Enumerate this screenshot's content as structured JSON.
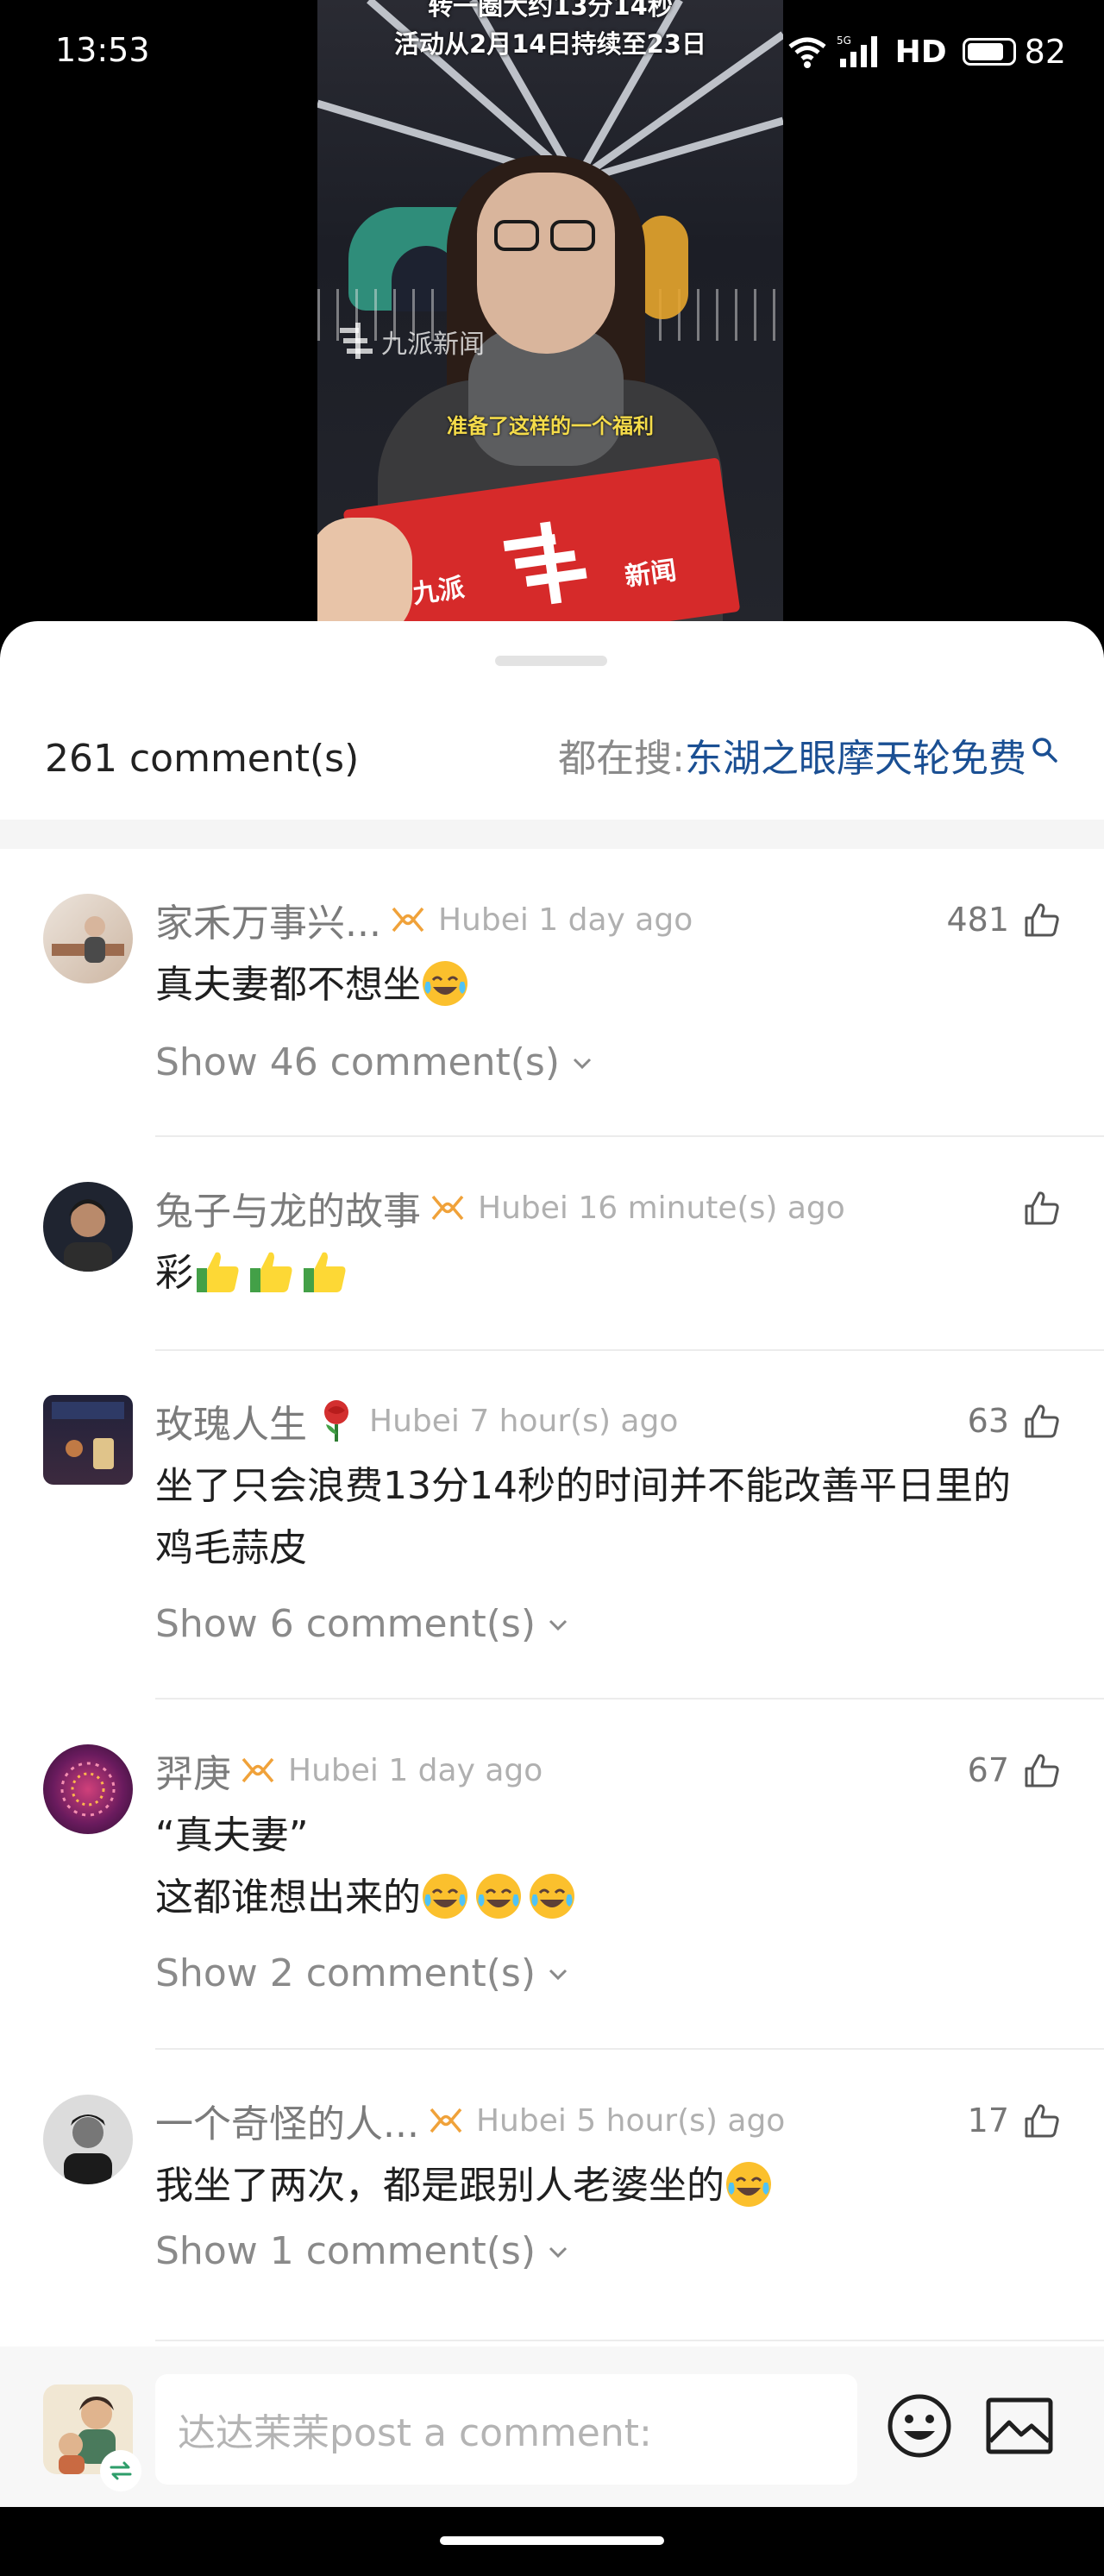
{
  "status_bar": {
    "time": "13:53",
    "network": "5G",
    "hd": "HD",
    "battery": "82",
    "battery_level": 0.82
  },
  "video": {
    "caption_partial": "转一圈大约13分14秒",
    "caption_top": "活动从2月14日持续至23日",
    "subtitle": "准备了这样的一个福利",
    "watermark": "九派新闻",
    "box_text_left": "九派",
    "box_text_right": "新闻"
  },
  "header": {
    "comment_count": "261 comment(s)",
    "trending_label": "都在搜: ",
    "trending_query": "东湖之眼摩天轮免费"
  },
  "comments": [
    {
      "username": "家禾万事兴...",
      "location_time": "Hubei 1 day ago",
      "likes": "481",
      "content": "真夫妻都不想坐",
      "replies": "Show 46 comment(s)"
    },
    {
      "username": "兔子与龙的故事",
      "location_time": "Hubei 16 minute(s) ago",
      "likes": "",
      "content": "彩"
    },
    {
      "username": "玫瑰人生",
      "location_time": "Hubei 7 hour(s) ago",
      "likes": "63",
      "content_line1": "坐了只会浪费13分14秒的时间并不能改善平日里的",
      "content_line2": "鸡毛蒜皮",
      "replies": "Show 6 comment(s)"
    },
    {
      "username": "羿庚",
      "location_time": "Hubei 1 day ago",
      "likes": "67",
      "content_line1": "“真夫妻”",
      "content_line2": "这都谁想出来的",
      "replies": "Show 2 comment(s)"
    },
    {
      "username": "一个奇怪的人...",
      "location_time": "Hubei 5 hour(s) ago",
      "likes": "17",
      "content": "我坐了两次，都是跟别人老婆坐的",
      "replies": "Show 1 comment(s)"
    }
  ],
  "input": {
    "placeholder": "达达茉茉post a comment:"
  },
  "icons": {
    "badge": "vip-badge-icon",
    "like": "thumbs-up-outline-icon",
    "emoji_laugh": "laughing-crying-emoji",
    "emoji_thumbs": "thumbs-up-emoji",
    "emoji_rose": "rose-emoji",
    "emoji_button": "smiley-icon",
    "image_button": "image-icon",
    "search": "search-icon",
    "chevron": "chevron-down-icon"
  },
  "colors": {
    "trending_link": "#1a4f93",
    "badge": "#f0a23a",
    "subtitle": "#f5dc4a",
    "username": "#7b7b7b",
    "meta": "#b0b0b0"
  }
}
